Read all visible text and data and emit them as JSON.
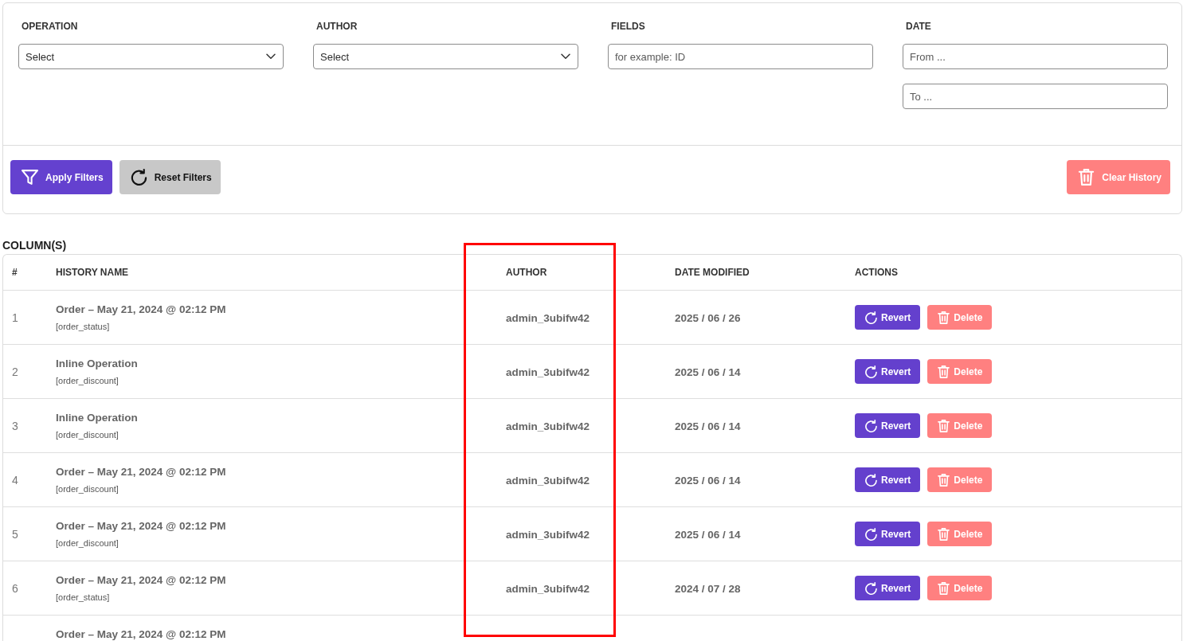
{
  "filters": [
    {
      "label": "OPERATION",
      "kind": "select",
      "fields": [
        {
          "value": "Select"
        }
      ]
    },
    {
      "label": "AUTHOR",
      "kind": "select",
      "fields": [
        {
          "value": "Select"
        }
      ]
    },
    {
      "label": "FIELDS",
      "kind": "text",
      "fields": [
        {
          "placeholder": "for example: ID"
        }
      ]
    },
    {
      "label": "DATE",
      "kind": "text",
      "fields": [
        {
          "placeholder": "From ..."
        },
        {
          "placeholder": "To ..."
        }
      ]
    }
  ],
  "buttons": [
    {
      "kind": "apply",
      "label": "Apply Filters"
    },
    {
      "kind": "reset",
      "label": "Reset Filters"
    },
    {
      "kind": "clear",
      "label": "Clear History"
    }
  ],
  "table": {
    "title": "COLUMN(S)",
    "columns": [
      {
        "label": "#",
        "highlighted": false
      },
      {
        "label": "HISTORY NAME",
        "highlighted": false
      },
      {
        "label": "AUTHOR",
        "highlighted": true
      },
      {
        "label": "DATE MODIFIED",
        "highlighted": false
      },
      {
        "label": "ACTIONS",
        "highlighted": false
      }
    ],
    "rows": [
      {
        "number": "1",
        "name": "Order – May 21, 2024 @ 02:12 PM",
        "field": "[order_status]",
        "author": "admin_3ubifw42",
        "date": "2025 / 06 / 26",
        "actions": [
          {
            "kind": "revert",
            "label": "Revert"
          },
          {
            "kind": "delete",
            "label": "Delete"
          }
        ]
      },
      {
        "number": "2",
        "name": "Inline Operation",
        "field": "[order_discount]",
        "author": "admin_3ubifw42",
        "date": "2025 / 06 / 14",
        "actions": [
          {
            "kind": "revert",
            "label": "Revert"
          },
          {
            "kind": "delete",
            "label": "Delete"
          }
        ]
      },
      {
        "number": "3",
        "name": "Inline Operation",
        "field": "[order_discount]",
        "author": "admin_3ubifw42",
        "date": "2025 / 06 / 14",
        "actions": [
          {
            "kind": "revert",
            "label": "Revert"
          },
          {
            "kind": "delete",
            "label": "Delete"
          }
        ]
      },
      {
        "number": "4",
        "name": "Order – May 21, 2024 @ 02:12 PM",
        "field": "[order_discount]",
        "author": "admin_3ubifw42",
        "date": "2025 / 06 / 14",
        "actions": [
          {
            "kind": "revert",
            "label": "Revert"
          },
          {
            "kind": "delete",
            "label": "Delete"
          }
        ]
      },
      {
        "number": "5",
        "name": "Order – May 21, 2024 @ 02:12 PM",
        "field": "[order_discount]",
        "author": "admin_3ubifw42",
        "date": "2025 / 06 / 14",
        "actions": [
          {
            "kind": "revert",
            "label": "Revert"
          },
          {
            "kind": "delete",
            "label": "Delete"
          }
        ]
      },
      {
        "number": "6",
        "name": "Order – May 21, 2024 @ 02:12 PM",
        "field": "[order_status]",
        "author": "admin_3ubifw42",
        "date": "2024 / 07 / 28",
        "actions": [
          {
            "kind": "revert",
            "label": "Revert"
          },
          {
            "kind": "delete",
            "label": "Delete"
          }
        ]
      },
      {
        "name": "Order – May 21, 2024 @ 02:12 PM"
      }
    ]
  }
}
